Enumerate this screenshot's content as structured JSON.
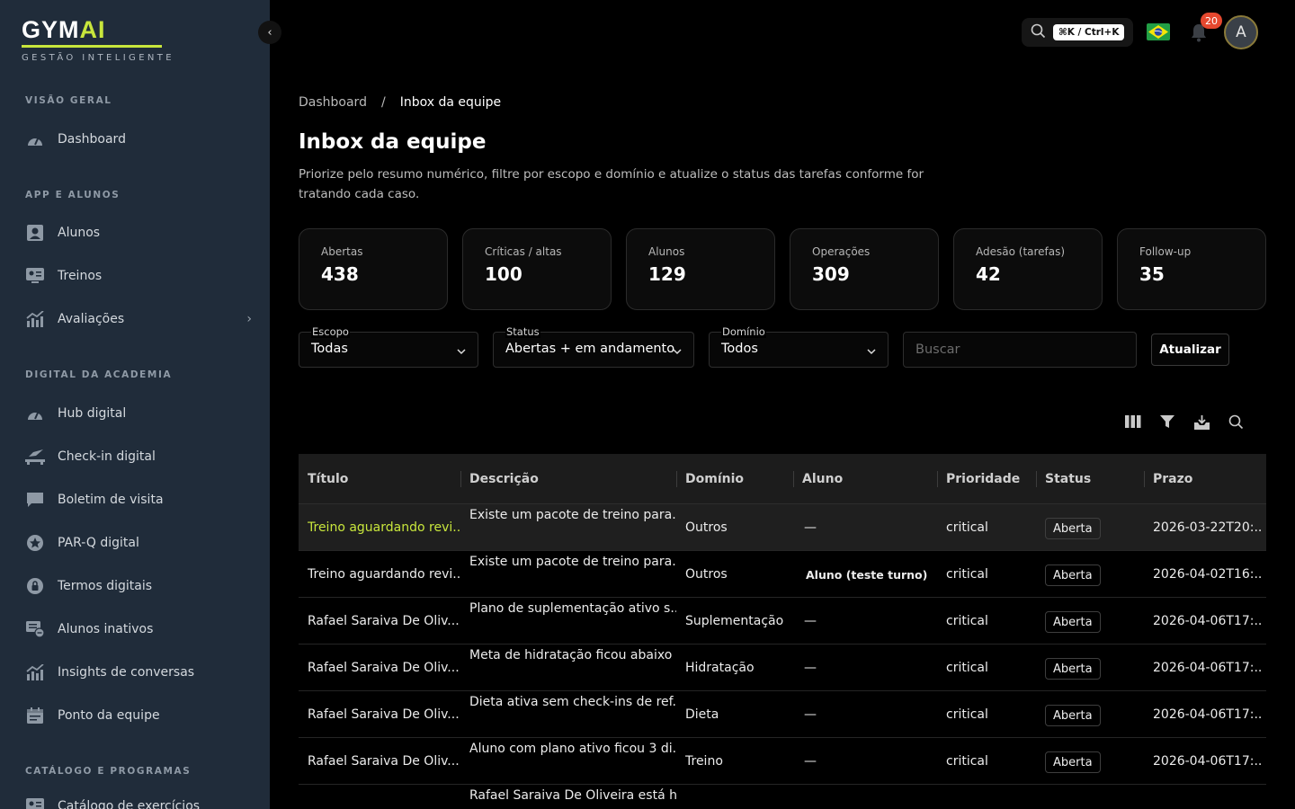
{
  "brand": {
    "name_main": "GYM",
    "name_accent": "AI",
    "tagline": "GESTÃO INTELIGENTE"
  },
  "sidebar": {
    "sections": [
      {
        "title": "VISÃO GERAL",
        "items": [
          {
            "label": "Dashboard",
            "icon": "dashboard-gauge-icon"
          }
        ]
      },
      {
        "title": "APP E ALUNOS",
        "items": [
          {
            "label": "Alunos",
            "icon": "person-icon"
          },
          {
            "label": "Treinos",
            "icon": "training-board-icon"
          },
          {
            "label": "Avaliações",
            "icon": "chart-up-icon",
            "has_submenu": true
          }
        ]
      },
      {
        "title": "DIGITAL DA ACADEMIA",
        "items": [
          {
            "label": "Hub digital",
            "icon": "gauge-icon"
          },
          {
            "label": "Check-in digital",
            "icon": "checkin-icon"
          },
          {
            "label": "Boletim de visita",
            "icon": "chat-icon"
          },
          {
            "label": "PAR-Q digital",
            "icon": "star-badge-icon"
          },
          {
            "label": "Termos digitais",
            "icon": "lock-icon"
          },
          {
            "label": "Alunos inativos",
            "icon": "inactive-list-icon"
          },
          {
            "label": "Insights de conversas",
            "icon": "chart-up-icon"
          },
          {
            "label": "Ponto da equipe",
            "icon": "calendar-icon"
          }
        ]
      },
      {
        "title": "CATÁLOGO E PROGRAMAS",
        "items": [
          {
            "label": "Catálogo de exercícios",
            "icon": "training-board-icon"
          }
        ]
      }
    ],
    "collapse_icon": "chevron-left-icon"
  },
  "topbar": {
    "search_icon": "search-icon",
    "shortcut": "⌘K / Ctrl+K",
    "language_flag": "brazil-flag-icon",
    "notifications_count": "20",
    "avatar_initial": "A"
  },
  "breadcrumb": {
    "parent": "Dashboard",
    "separator": "/",
    "current": "Inbox da equipe"
  },
  "page": {
    "title": "Inbox da equipe",
    "subtitle": "Priorize pelo resumo numérico, filtre por escopo e domínio e atualize o status das tarefas conforme for tratando cada caso."
  },
  "stats": [
    {
      "label": "Abertas",
      "value": "438"
    },
    {
      "label": "Críticas / altas",
      "value": "100"
    },
    {
      "label": "Alunos",
      "value": "129"
    },
    {
      "label": "Operações",
      "value": "309"
    },
    {
      "label": "Adesão (tarefas)",
      "value": "42"
    },
    {
      "label": "Follow-up",
      "value": "35"
    }
  ],
  "filters": {
    "scope": {
      "label": "Escopo",
      "value": "Todas"
    },
    "status": {
      "label": "Status",
      "value": "Abertas + em andamento"
    },
    "domain": {
      "label": "Domínio",
      "value": "Todos"
    },
    "search_placeholder": "Buscar",
    "update_button": "Atualizar"
  },
  "table_tools": [
    "columns-icon",
    "filter-icon",
    "download-icon",
    "search-icon"
  ],
  "table": {
    "columns": [
      "Título",
      "Descrição",
      "Domínio",
      "Aluno",
      "Prioridade",
      "Status",
      "Prazo"
    ],
    "rows": [
      {
        "title": "Treino aguardando revi...",
        "description": "Existe um pacote de treino para...",
        "domain": "Outros",
        "student": "—",
        "priority": "critical",
        "status": "Aberta",
        "due": "2026-03-22T20:...",
        "selected": true
      },
      {
        "title": "Treino aguardando revi...",
        "description": "Existe um pacote de treino para...",
        "domain": "Outros",
        "student": "Aluno (teste turno)",
        "priority": "critical",
        "status": "Aberta",
        "due": "2026-04-02T16:..."
      },
      {
        "title": "Rafael Saraiva De Oliv...",
        "description": "Plano de suplementação ativo s...",
        "domain": "Suplementação",
        "student": "—",
        "priority": "critical",
        "status": "Aberta",
        "due": "2026-04-06T17:..."
      },
      {
        "title": "Rafael Saraiva De Oliv...",
        "description": "Meta de hidratação ficou abaixo ...",
        "domain": "Hidratação",
        "student": "—",
        "priority": "critical",
        "status": "Aberta",
        "due": "2026-04-06T17:..."
      },
      {
        "title": "Rafael Saraiva De Oliv...",
        "description": "Dieta ativa sem check-ins de ref...",
        "domain": "Dieta",
        "student": "—",
        "priority": "critical",
        "status": "Aberta",
        "due": "2026-04-06T17:..."
      },
      {
        "title": "Rafael Saraiva De Oliv...",
        "description": "Aluno com plano ativo ficou 3 di...",
        "domain": "Treino",
        "student": "—",
        "priority": "critical",
        "status": "Aberta",
        "due": "2026-04-06T17:..."
      },
      {
        "title": "",
        "description": "Rafael Saraiva De Oliveira está h...",
        "domain": "",
        "student": "",
        "priority": "",
        "status": "",
        "due": ""
      }
    ]
  },
  "colors": {
    "accent": "#c8e63c",
    "sidebar_bg": "#202c3a",
    "badge": "#e5482f"
  }
}
